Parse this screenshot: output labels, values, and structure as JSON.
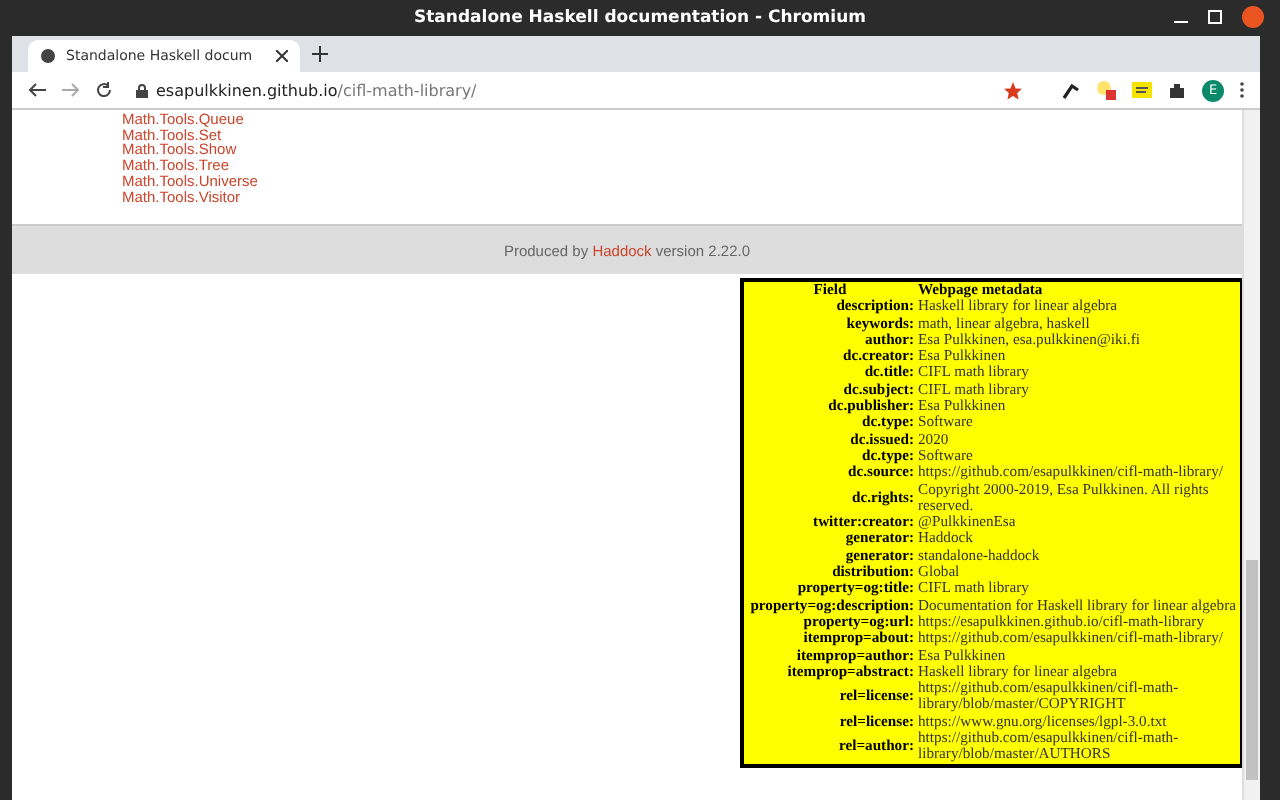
{
  "window": {
    "title": "Standalone Haskell documentation - Chromium"
  },
  "tab": {
    "title": "Standalone Haskell docum"
  },
  "address_bar": {
    "host": "esapulkkinen.github.io",
    "path": "/cifl-math-library/"
  },
  "avatar": {
    "letter": "E"
  },
  "module_links": [
    "Math.Tools.Queue",
    "Math.Tools.Set",
    "Math.Tools.Show",
    "Math.Tools.Tree",
    "Math.Tools.Universe",
    "Math.Tools.Visitor"
  ],
  "footer": {
    "before": "Produced by",
    "link": "Haddock",
    "after": "version 2.22.0"
  },
  "metadata": {
    "columns": [
      "Field",
      "Webpage metadata"
    ],
    "rows": [
      {
        "field": "description:",
        "value": "Haskell library for linear algebra"
      },
      {
        "field": "keywords:",
        "value": "math, linear algebra, haskell"
      },
      {
        "field": "author:",
        "value": "Esa Pulkkinen, esa.pulkkinen@iki.fi"
      },
      {
        "field": "dc.creator:",
        "value": "Esa Pulkkinen"
      },
      {
        "field": "dc.title:",
        "value": "CIFL math library"
      },
      {
        "field": "dc.subject:",
        "value": "CIFL math library"
      },
      {
        "field": "dc.publisher:",
        "value": "Esa Pulkkinen"
      },
      {
        "field": "dc.type:",
        "value": "Software"
      },
      {
        "field": "dc.issued:",
        "value": "2020"
      },
      {
        "field": "dc.type:",
        "value": "Software"
      },
      {
        "field": "dc.source:",
        "value": "https://github.com/esapulkkinen/cifl-math-library/"
      },
      {
        "field": "dc.rights:",
        "value": "Copyright 2000-2019, Esa Pulkkinen. All rights reserved."
      },
      {
        "field": "twitter:creator:",
        "value": "@PulkkinenEsa"
      },
      {
        "field": "generator:",
        "value": "Haddock"
      },
      {
        "field": "generator:",
        "value": "standalone-haddock"
      },
      {
        "field": "distribution:",
        "value": "Global"
      },
      {
        "field": "property=og:title:",
        "value": "CIFL math library"
      },
      {
        "field": "property=og:description:",
        "value": "Documentation for Haskell library for linear algebra"
      },
      {
        "field": "property=og:url:",
        "value": "https://esapulkkinen.github.io/cifl-math-library"
      },
      {
        "field": "itemprop=about:",
        "value": "https://github.com/esapulkkinen/cifl-math-library/"
      },
      {
        "field": "itemprop=author:",
        "value": "Esa Pulkkinen"
      },
      {
        "field": "itemprop=abstract:",
        "value": "Haskell library for linear algebra"
      },
      {
        "field": "rel=license:",
        "value": "https://github.com/esapulkkinen/cifl-math-library/blob/master/COPYRIGHT"
      },
      {
        "field": "rel=license:",
        "value": "https://www.gnu.org/licenses/lgpl-3.0.txt"
      },
      {
        "field": "rel=author:",
        "value": "https://github.com/esapulkkinen/cifl-math-library/blob/master/AUTHORS"
      }
    ]
  }
}
